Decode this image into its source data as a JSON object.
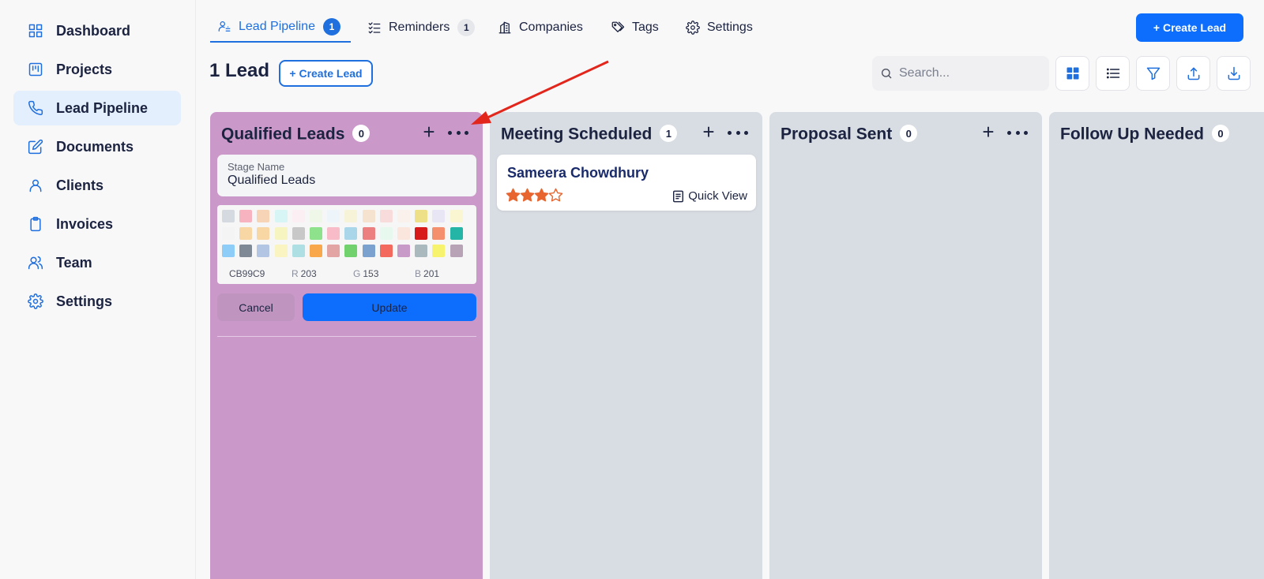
{
  "sidebar": {
    "items": [
      {
        "label": "Dashboard",
        "icon": "grid-icon",
        "active": false
      },
      {
        "label": "Projects",
        "icon": "kanban-icon",
        "active": false
      },
      {
        "label": "Lead Pipeline",
        "icon": "phone-icon",
        "active": true
      },
      {
        "label": "Documents",
        "icon": "edit-icon",
        "active": false
      },
      {
        "label": "Clients",
        "icon": "user-icon",
        "active": false
      },
      {
        "label": "Invoices",
        "icon": "clipboard-icon",
        "active": false
      },
      {
        "label": "Team",
        "icon": "users-icon",
        "active": false
      },
      {
        "label": "Settings",
        "icon": "gear-icon",
        "active": false
      }
    ]
  },
  "tabs": [
    {
      "label": "Lead Pipeline",
      "badge": "1",
      "icon": "person-pipeline-icon"
    },
    {
      "label": "Reminders",
      "badge": "1",
      "icon": "checklist-icon"
    },
    {
      "label": "Companies",
      "icon": "building-icon"
    },
    {
      "label": "Tags",
      "icon": "tags-icon"
    },
    {
      "label": "Settings",
      "icon": "gear-icon"
    }
  ],
  "header": {
    "create_lead_label": "+ Create Lead",
    "lead_count": "1 Lead",
    "create_lead_outline_label": "+ Create Lead",
    "search_placeholder": "Search..."
  },
  "columns": [
    {
      "title": "Qualified Leads",
      "count": "0",
      "color": "#CB99C9"
    },
    {
      "title": "Meeting Scheduled",
      "count": "1",
      "color": "#D8DCE3"
    },
    {
      "title": "Proposal Sent",
      "count": "0",
      "color": "#D8DCE3"
    },
    {
      "title": "Follow Up Needed",
      "count": "0",
      "color": "#D8DCE3"
    }
  ],
  "stage_editor": {
    "field_label": "Stage Name",
    "field_value": "Qualified Leads",
    "hex": "CB99C9",
    "r_label": "R",
    "r_value": "203",
    "g_label": "G",
    "g_value": "153",
    "b_label": "B",
    "b_value": "201",
    "cancel_label": "Cancel",
    "update_label": "Update",
    "palette": [
      [
        "#D5D9E0",
        "#F7B3C0",
        "#F8D4B6",
        "#D8F5F5",
        "#FBEFF3",
        "#EEF7E8",
        "#EEF5FA",
        "#F6F3D8",
        "#F6E3CF",
        "#F8DCDC",
        "#FBF1EC",
        "#EDE089",
        "#E8E6F5",
        "#F9F6D1"
      ],
      [
        "#F4F4F4",
        "#F9D7A5",
        "#F9D7A5",
        "#F6F4C1",
        "#C8C8C8",
        "#8EE28C",
        "#F7BCC8",
        "#A9D6E8",
        "#EC7F7F",
        "#E7F9EF",
        "#FBE6DD",
        "#D71A1A",
        "#F5906E",
        "#25B5A6"
      ],
      [
        "#8FCDF9",
        "#7F8995",
        "#B2C5E2",
        "#F9F4C1",
        "#AEDFE3",
        "#F8A84A",
        "#E3A4A4",
        "#71D26D",
        "#7BA2CF",
        "#F4695E",
        "#C89AC8",
        "#A9B9BE",
        "#F7F36E",
        "#B7A2B6"
      ]
    ]
  },
  "lead_card": {
    "name": "Sameera Chowdhury",
    "rating": 3,
    "rating_max": 4,
    "star_color": "#E8652F",
    "quick_view_label": "Quick View"
  },
  "colors": {
    "accent": "#0D6EFD",
    "annotation_arrow": "#E3261B"
  }
}
